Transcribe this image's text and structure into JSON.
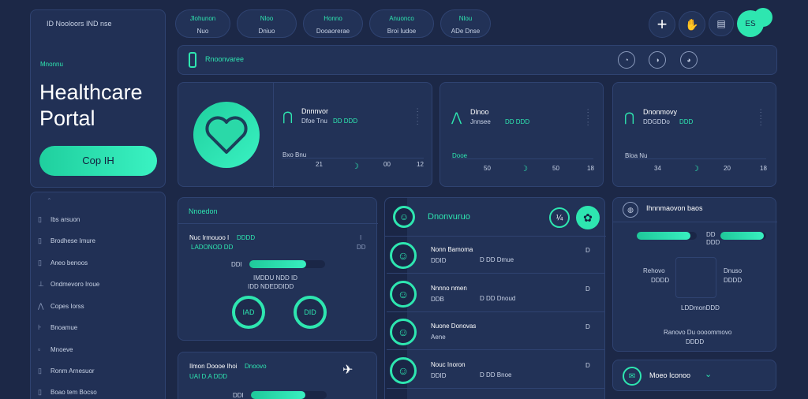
{
  "sidebar": {
    "top_label": "ID Nooloors  IND nse",
    "section_label": "Mnonnu",
    "title_line1": "Healthcare",
    "title_line2": "Portal",
    "cta_label": "Cop IH",
    "items": [
      {
        "label": "Ibs arsuon"
      },
      {
        "label": "Brodhese Imure"
      },
      {
        "label": "Aneo benoos"
      },
      {
        "label": "Ondmevoro Iroue"
      },
      {
        "label": "Copes Iorss"
      },
      {
        "label": "Bnoamue"
      },
      {
        "label": "Mnoeve"
      },
      {
        "label": "Ronm Arnesuor"
      },
      {
        "label": "Boao tem Bocso"
      }
    ]
  },
  "top_pills": [
    {
      "line1": "Jlohunon",
      "line2": "Nuo"
    },
    {
      "line1": "Nloo",
      "line2": "Dniuo"
    },
    {
      "line1": "Honno",
      "line2": "Dooaorerae"
    },
    {
      "line1": "Anuonco",
      "line2": "Broi Iudoe"
    },
    {
      "line1": "Nlou",
      "line2": "ADe Dnse"
    }
  ],
  "header_actions": {
    "avatar_label": "ES"
  },
  "banner": {
    "label": "Rnoonvaree"
  },
  "stat_cards": [
    {
      "title": "Dnnnvor",
      "sub_a": "Dfoe Tnu",
      "sub_b": "DD DDD",
      "row_label": "Bxo Bnu",
      "v1": "21",
      "v2": "00",
      "v3": "12"
    },
    {
      "title": "Dlnoo",
      "sub_a": "Jnnsee",
      "sub_b": "DD DDD",
      "row_label": "Dooe",
      "v1": "50",
      "v2": "50",
      "v3": "18"
    },
    {
      "title": "Dnonmovy",
      "sub_a": "DDGDDo",
      "sub_b": "DDD",
      "row_label": "Bloa Nu",
      "v1": "34",
      "v2": "20",
      "v3": "18"
    }
  ],
  "left_panel": {
    "heading": "Nnoedon",
    "line1_a": "Nuc Irmouoo I",
    "line1_b": "DDDD",
    "line2": "LADONOD DD",
    "bar_label": "DDI",
    "bar_value": 0.75,
    "meta": "IMDDU NDD ID",
    "meta2": "IDD NDEDDIDD",
    "ring1": "IAD",
    "ring2": "DID"
  },
  "left_panel2": {
    "heading_a": "Ilmon Doooe Ihoi",
    "heading_b": "Dnoovo",
    "sub": "UAI D.A DDD",
    "bar_label": "DDI",
    "bar_value": 0.72
  },
  "mid_panel": {
    "heading": "Dnonvuruo",
    "rows": [
      {
        "title": "Nonn Bamoma",
        "sub": "DDID",
        "meta": "D DD  Dmue",
        "end": "D"
      },
      {
        "title": "Nnnno nmen",
        "sub": "DDB",
        "meta": "D  DD  Dnoud",
        "end": "D"
      },
      {
        "title": "Nuone Donovas",
        "sub": "Aene",
        "meta": "",
        "end": "D"
      },
      {
        "title": "Nouc Inoron",
        "sub": "DDID",
        "meta": "D  DD  Bnoe",
        "end": "D"
      }
    ]
  },
  "right_panel": {
    "heading": "Ihnnmaovon baos",
    "bar1_value": 0.9,
    "bar1_label": "DD",
    "bar1_sub": "DDD",
    "bar2_value": 0.95,
    "left_label": "Rehovo",
    "left_sub": "DDDD",
    "right_label": "Dnuso",
    "right_sub": "DDDD",
    "caption1": "LDDmonDDD",
    "caption2": "Ranovo Du oooommovo",
    "caption3": "DDDD"
  },
  "right_panel2": {
    "label": "Moeo Iconoo"
  }
}
